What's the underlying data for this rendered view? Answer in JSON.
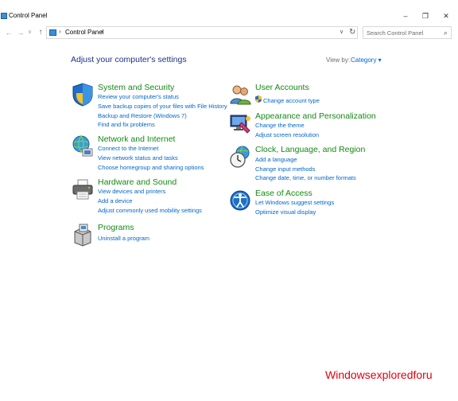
{
  "window": {
    "title": "Control Panel",
    "minimize_glyph": "–",
    "maximize_glyph": "❐",
    "close_glyph": "✕"
  },
  "addressbar": {
    "back_glyph": "←",
    "forward_glyph": "→",
    "recent_glyph": "∨",
    "up_glyph": "↑",
    "separator": "›",
    "crumb": "Control Panel",
    "dropdown_glyph": "∨",
    "refresh_glyph": "↻",
    "search_placeholder": "Search Control Panel",
    "search_glyph": "⌕"
  },
  "main": {
    "title": "Adjust your computer's settings",
    "view_by_label": "View by:",
    "view_by_value": "Category ▾"
  },
  "categories": [
    {
      "title": "System and Security",
      "icon": "shield-icon",
      "links": [
        "Review your computer's status",
        "Save backup copies of your files with File History",
        "Backup and Restore (Windows 7)",
        "Find and fix problems"
      ]
    },
    {
      "title": "Network and Internet",
      "icon": "network-globe-icon",
      "links": [
        "Connect to the Internet",
        "View network status and tasks",
        "Choose homegroup and sharing options"
      ]
    },
    {
      "title": "Hardware and Sound",
      "icon": "printer-icon",
      "links": [
        "View devices and printers",
        "Add a device",
        "Adjust commonly used mobility settings"
      ]
    },
    {
      "title": "Programs",
      "icon": "programs-box-icon",
      "links": [
        "Uninstall a program"
      ]
    },
    {
      "title": "User Accounts",
      "icon": "users-icon",
      "links": [
        "Change account type"
      ]
    },
    {
      "title": "Appearance and Personalization",
      "icon": "monitor-paint-icon",
      "links": [
        "Change the theme",
        "Adjust screen resolution"
      ]
    },
    {
      "title": "Clock, Language, and Region",
      "icon": "clock-globe-icon",
      "links": [
        "Add a language",
        "Change input methods",
        "Change date, time, or number formats"
      ]
    },
    {
      "title": "Ease of Access",
      "icon": "accessibility-icon",
      "links": [
        "Let Windows suggest settings",
        "Optimize visual display"
      ]
    }
  ],
  "watermark": "Windowsexploredforu"
}
